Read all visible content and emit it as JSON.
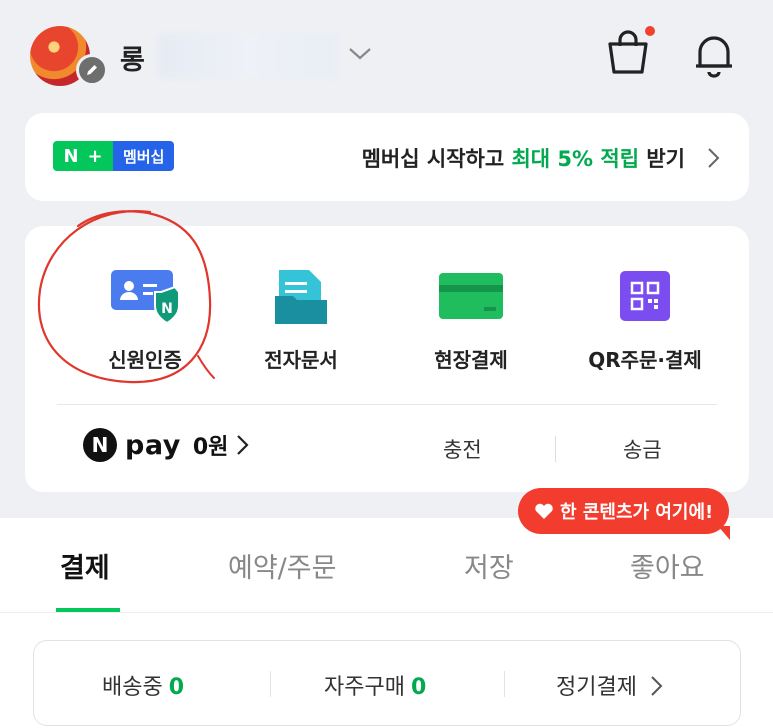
{
  "header": {
    "username": "롱",
    "cart_badge_color": "#f24130"
  },
  "banner": {
    "badge_n": "N",
    "badge_plus": "+",
    "badge_label": "멤버십",
    "text_before": "멤버십 시작하고 ",
    "text_highlight": "최대 5% 적립",
    "text_after": " 받기"
  },
  "services": [
    {
      "label": "신원인증",
      "icon": "id-card-shield-icon"
    },
    {
      "label": "전자문서",
      "icon": "document-folder-icon"
    },
    {
      "label": "현장결제",
      "icon": "credit-card-icon"
    },
    {
      "label": "QR주문·결제",
      "icon": "qr-code-icon"
    }
  ],
  "pay": {
    "logo_letter": "N",
    "word": "pay",
    "balance": "0원",
    "charge": "충전",
    "send": "송금"
  },
  "bubble": {
    "text": "한 콘텐츠가 여기에!"
  },
  "tabs": [
    {
      "label": "결제"
    },
    {
      "label": "예약/주문"
    },
    {
      "label": "저장"
    },
    {
      "label": "좋아요"
    }
  ],
  "status": {
    "shipping_label": "배송중",
    "shipping_count": "0",
    "frequent_label": "자주구매",
    "frequent_count": "0",
    "recurring_label": "정기결제"
  },
  "colors": {
    "brand_green": "#03c75a",
    "accent_red": "#f23c2e",
    "membership_blue": "#2563e8"
  }
}
